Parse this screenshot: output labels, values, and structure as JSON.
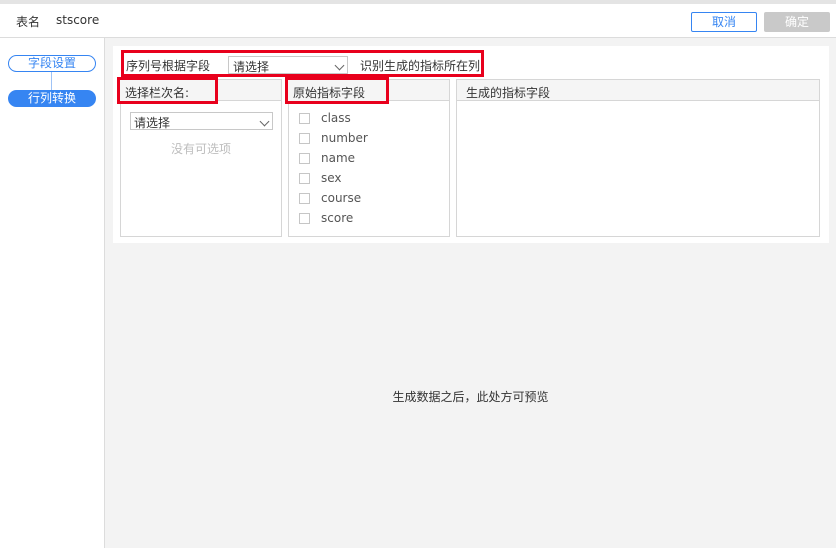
{
  "header": {
    "table_label": "表名",
    "table_name": "stscore",
    "cancel_label": "取消",
    "confirm_label": "确定"
  },
  "sidebar": {
    "items": [
      {
        "label": "字段设置",
        "active": false
      },
      {
        "label": "行列转换",
        "active": true
      }
    ]
  },
  "serial": {
    "label": "序列号根据字段",
    "select_value": "请选择",
    "hint": "识别生成的指标所在列"
  },
  "panels": {
    "column_name": {
      "title": "选择栏次名:",
      "select_value": "请选择",
      "empty_text": "没有可选项"
    },
    "source_fields": {
      "title": "原始指标字段",
      "fields": [
        "class",
        "number",
        "name",
        "sex",
        "course",
        "score"
      ]
    },
    "generated_fields": {
      "title": "生成的指标字段"
    }
  },
  "preview_text": "生成数据之后，此处方可预览",
  "colors": {
    "accent": "#3685f2",
    "highlight": "#e8001c",
    "disabled": "#c9c9c9"
  }
}
